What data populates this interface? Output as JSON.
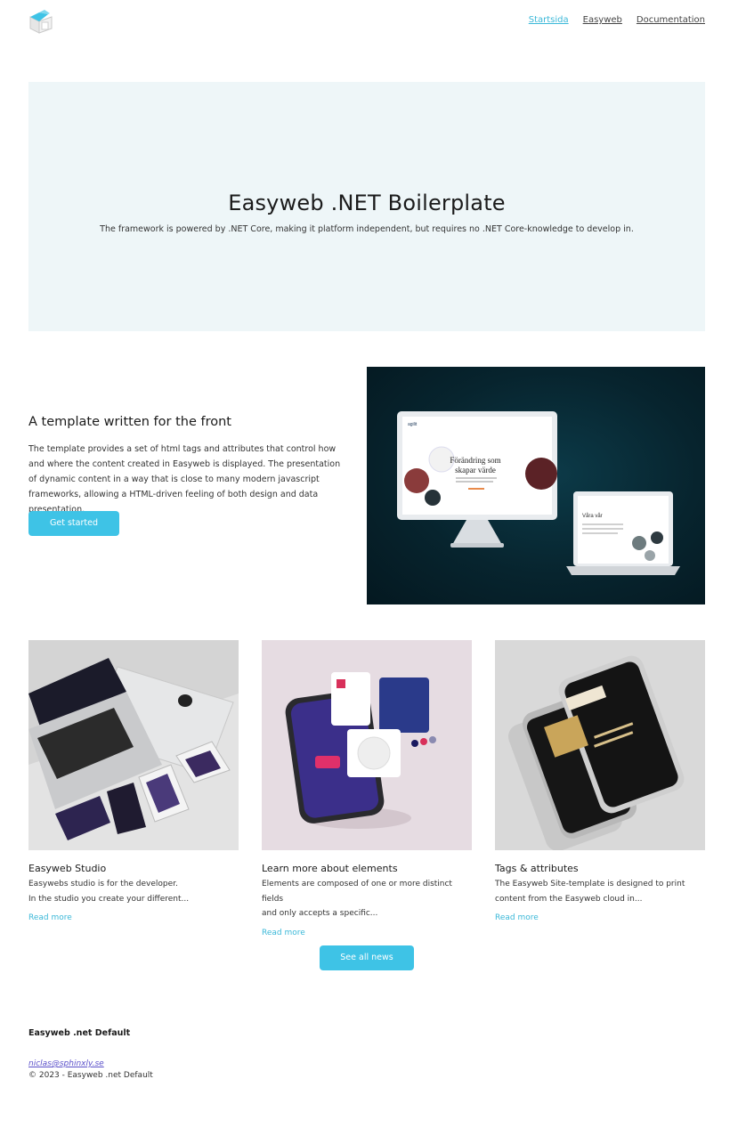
{
  "header": {
    "nav": [
      {
        "label": "Startsida",
        "active": true
      },
      {
        "label": "Easyweb",
        "active": false
      },
      {
        "label": "Documentation",
        "active": false
      }
    ]
  },
  "hero": {
    "title": "Easyweb .NET Boilerplate",
    "subtitle": "The framework is powered by .NET Core, making it platform independent, but requires no .NET Core-knowledge to develop in."
  },
  "feature": {
    "title": "A template written for the front",
    "body": "The template provides a set of html tags and attributes that control how and where the content created in Easyweb is displayed. The presentation of dynamic content in a way that is close to many modern javascript frameworks, allowing a HTML-driven feeling of both design and data presentation.",
    "button_label": "Get started",
    "mockup": {
      "desktop_brand": "agilit",
      "desktop_headline_1": "Förändring som",
      "desktop_headline_2": "skapar värde",
      "laptop_headline": "Våra vår"
    }
  },
  "cards": [
    {
      "title": "Easyweb Studio",
      "line1": "Easywebs studio is for the developer.",
      "line2": "In the studio you create your different...",
      "link": "Read more"
    },
    {
      "title": "Learn more about elements",
      "line1": "Elements are composed of one or more distinct fields",
      "line2": "and only accepts a specific...",
      "link": "Read more"
    },
    {
      "title": "Tags & attributes",
      "line1": "The Easyweb Site-template is designed to print",
      "line2": "content from the Easyweb cloud in...",
      "link": "Read more"
    }
  ],
  "see_all_label": "See all news",
  "footer": {
    "brand": "Easyweb .net Default",
    "email": "niclas@sphinxly.se",
    "copyright": "© 2023 - Easyweb .net Default"
  },
  "colors": {
    "accent": "#3ec3e6",
    "hero_bg": "#eef6f8",
    "link": "#3bb8d8"
  },
  "icons": {
    "logo": "isometric-box-icon"
  }
}
